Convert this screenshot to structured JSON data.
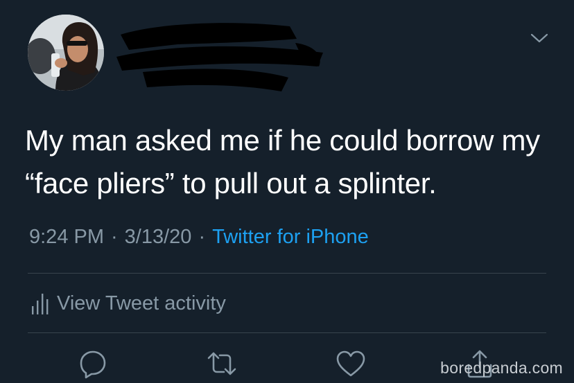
{
  "tweet": {
    "text": "My man asked me if he could borrow my “face pliers” to pull out a splinter.",
    "time": "9:24 PM",
    "separator": "·",
    "date": "3/13/20",
    "source": "Twitter for iPhone"
  },
  "activity": {
    "label": "View Tweet activity"
  },
  "actions": [
    "reply-icon",
    "retweet-icon",
    "like-icon",
    "share-icon"
  ],
  "watermark": "boredpanda.com",
  "colors": {
    "background": "#15202b",
    "text": "#ffffff",
    "muted": "#8899a6",
    "link": "#1da1f2",
    "divider": "#38444d"
  }
}
